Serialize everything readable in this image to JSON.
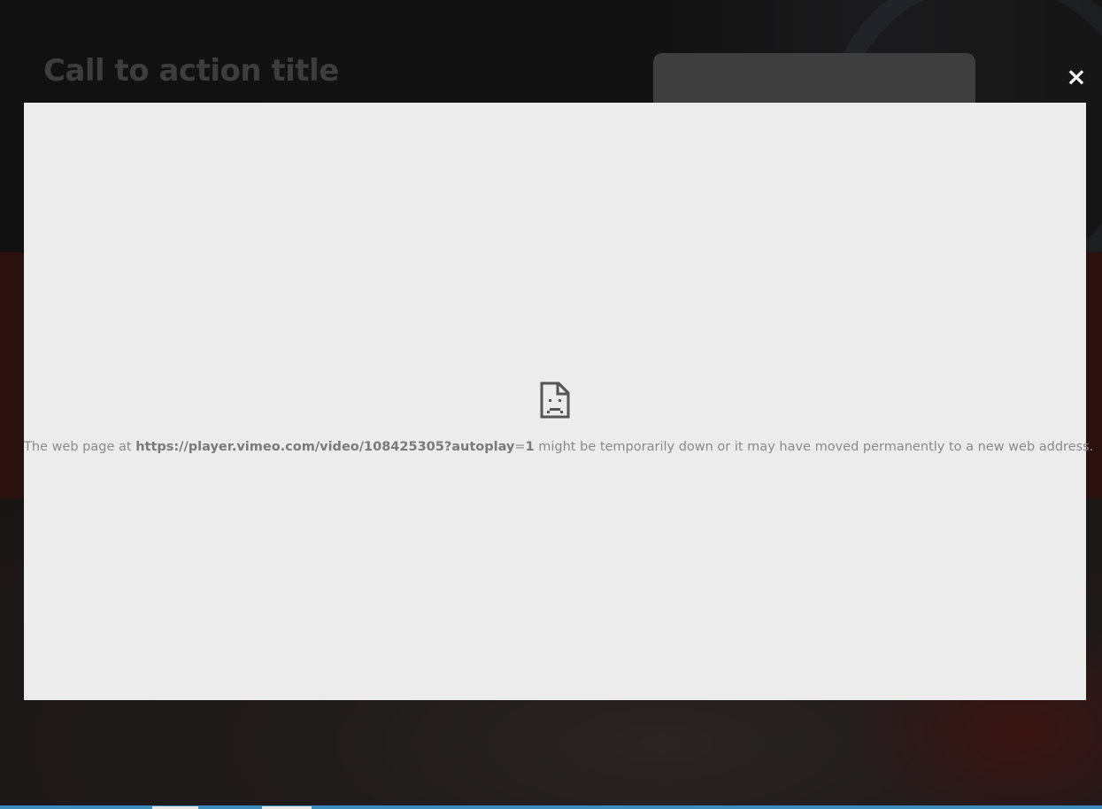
{
  "background": {
    "cta_title": "Call to action title"
  },
  "overlay": {
    "close_label": "×"
  },
  "modal": {
    "error": {
      "icon": "sad-document-icon",
      "prefix": "The web page at ",
      "url_bold": "https://player.vimeo.com/video/108425305?autoplay",
      "url_eq": "=",
      "url_val": "1",
      "suffix": " might be temporarily down or it may have moved permanently to a new web address."
    }
  },
  "colors": {
    "modal_bg": "#ececec",
    "overlay_dim": "#121212",
    "red_band": "#2a1110"
  }
}
